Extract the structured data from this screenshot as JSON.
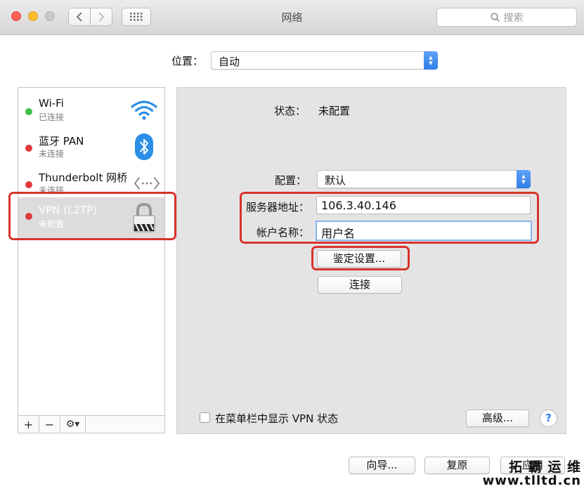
{
  "window": {
    "title": "网络",
    "search_placeholder": "搜索"
  },
  "location": {
    "label": "位置：",
    "value": "自动"
  },
  "services": [
    {
      "name": "Wi-Fi",
      "status": "已连接",
      "dot": "green",
      "icon": "wifi-icon"
    },
    {
      "name": "蓝牙 PAN",
      "status": "未连接",
      "dot": "red",
      "icon": "bluetooth-icon"
    },
    {
      "name": "Thunderbolt 网桥",
      "status": "未连接",
      "dot": "red",
      "icon": "thunderbolt-bridge-icon"
    },
    {
      "name": "VPN (L2TP)",
      "status": "未配置",
      "dot": "red",
      "icon": "lock-icon",
      "selected": true
    }
  ],
  "sidebar_buttons": {
    "add": "+",
    "remove": "−",
    "gear": "⚙▾"
  },
  "detail": {
    "status_label": "状态：",
    "status_value": "未配置",
    "config_label": "配置：",
    "config_value": "默认",
    "server_label": "服务器地址：",
    "server_value": "106.3.40.146",
    "account_label": "帐户名称：",
    "account_value": "用户名",
    "auth_button": "鉴定设置...",
    "connect_button": "连接",
    "show_vpn_label": "在菜单栏中显示 VPN 状态",
    "advanced_button": "高级...",
    "help_button": "?"
  },
  "footer": {
    "assist_button": "向导...",
    "revert_button": "复原",
    "apply_button": "应用"
  },
  "watermark": {
    "line1": "拓 霸 运 维",
    "line2": "www.tlltd.cn"
  },
  "colors": {
    "highlight_box": "#d9332d",
    "accent": "#2f7de6"
  }
}
